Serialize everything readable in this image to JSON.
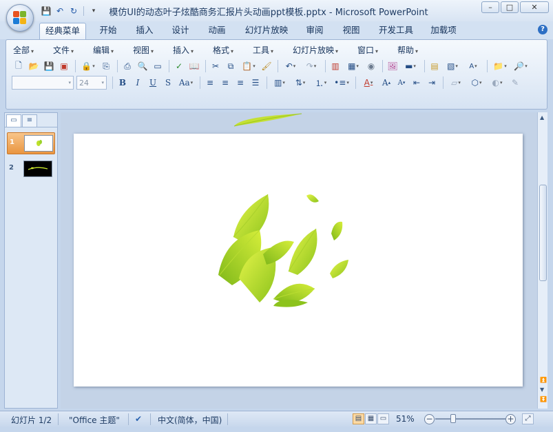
{
  "window": {
    "title": "模仿UI的动态叶子炫酷商务汇报片头动画ppt模板.pptx - Microsoft PowerPoint",
    "controls": [
      "–",
      "□",
      "✕"
    ]
  },
  "quick_access": {
    "save": "💾",
    "undo": "↶",
    "redo": "↻",
    "more": "▾"
  },
  "tabs": [
    {
      "label": "经典菜单",
      "active": true
    },
    {
      "label": "开始"
    },
    {
      "label": "插入"
    },
    {
      "label": "设计"
    },
    {
      "label": "动画"
    },
    {
      "label": "幻灯片放映"
    },
    {
      "label": "审阅"
    },
    {
      "label": "视图"
    },
    {
      "label": "开发工具"
    },
    {
      "label": "加载项"
    }
  ],
  "help": "?",
  "menus": [
    "全部",
    "文件",
    "编辑",
    "视图",
    "插入",
    "格式",
    "工具",
    "幻灯片放映",
    "窗口",
    "帮助"
  ],
  "font": {
    "name": "",
    "size": "24"
  },
  "format_buttons": {
    "bold": "B",
    "italic": "I",
    "underline": "U",
    "shadow": "S",
    "case": "Aa",
    "font_color": "A",
    "grow": "A",
    "shrink": "A"
  },
  "left_panel": {
    "tab_slides": "▭",
    "tab_outline": "≡",
    "slides": [
      {
        "num": "1",
        "selected": true
      },
      {
        "num": "2",
        "selected": false
      }
    ]
  },
  "status": {
    "slide": "幻灯片 1/2",
    "theme": "\"Office 主题\"",
    "language": "中文(简体，中国)",
    "zoom": "51%",
    "zoom_minus": "−",
    "zoom_plus": "+"
  },
  "colors": {
    "leaf_light": "#d6ee3a",
    "leaf_dark": "#8cc31c",
    "active_tab": "#ffffff",
    "selected_thumb": "#e99540"
  }
}
